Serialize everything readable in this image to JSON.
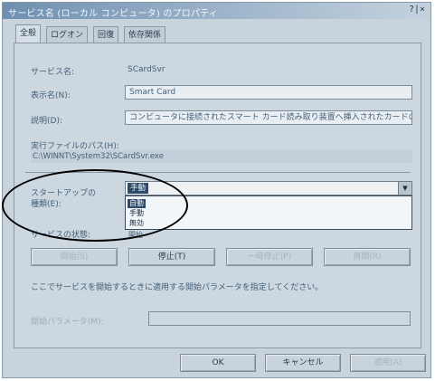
{
  "window": {
    "title": "サービス名 (ローカル コンピュータ) のプロパティ",
    "controls": "?|×"
  },
  "tabs": [
    "全般",
    "ログオン",
    "回復",
    "依存関係"
  ],
  "general": {
    "service_name_label": "サービス名:",
    "service_name_value": "SCardSvr",
    "display_name_label": "表示名(N):",
    "display_name_value": "Smart Card",
    "description_label": "説明(D):",
    "description_value": "コンピュータに接続されたスマート カード読み取り装置へ挿入されたカードの",
    "exe_path_label": "実行ファイルのパス(H):",
    "exe_path_value": "C:\\WINNT\\System32\\SCardSvr.exe",
    "startup_type_label_1": "スタートアップの",
    "startup_type_label_2": "種類(E):",
    "startup_type_selected": "手動",
    "startup_type_options": [
      "自動",
      "手動",
      "無効"
    ],
    "startup_type_highlighted": 0,
    "service_status_label": "サービスの状態:",
    "service_status_value": "開始"
  },
  "service_buttons": [
    "開始(S)",
    "停止(T)",
    "一時停止(P)",
    "再開(R)"
  ],
  "start_params_note": "ここでサービスを開始するときに適用する開始パラメータを指定してください。",
  "start_params_label": "開始パラメータ(M):",
  "start_params_value": "",
  "footer_buttons": [
    "OK",
    "キャンセル",
    "適用(A)"
  ]
}
